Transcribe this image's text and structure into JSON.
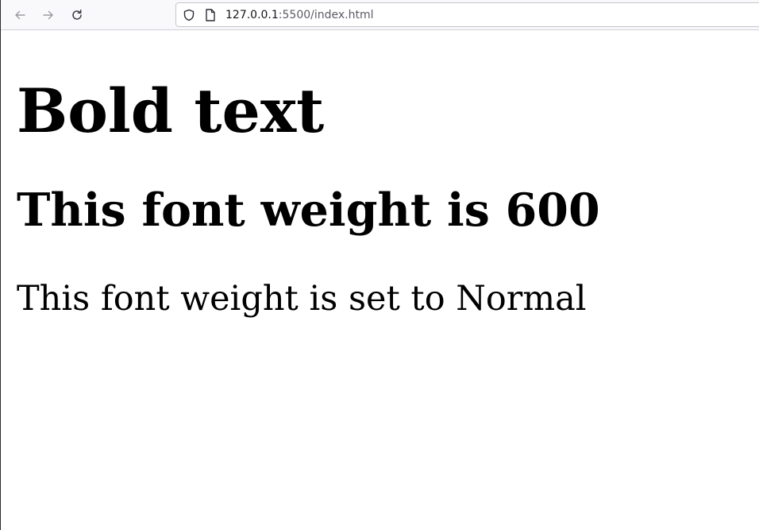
{
  "browser": {
    "url_host": "127.0.0.1",
    "url_rest": ":5500/index.html",
    "nav_icons": [
      "back-arrow-icon",
      "forward-arrow-icon",
      "reload-icon"
    ],
    "urlbar_icons": [
      "shield-icon",
      "page-icon"
    ]
  },
  "content": {
    "heading_bold": "Bold text",
    "heading_600": "This font weight is 600",
    "paragraph_normal": "This font weight is set to Normal"
  }
}
